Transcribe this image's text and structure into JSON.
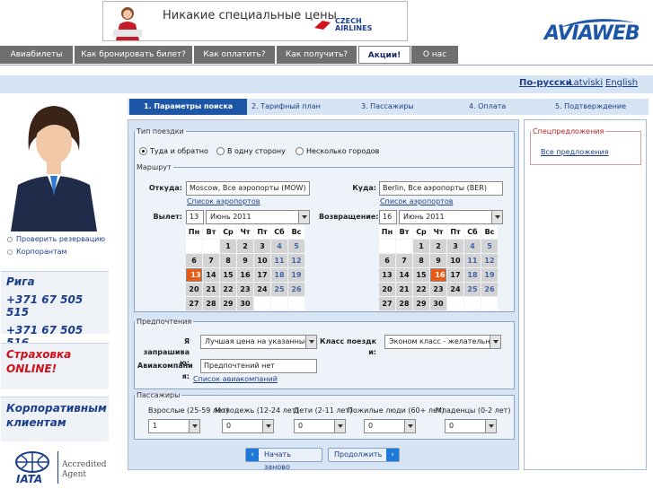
{
  "banner": {
    "text": "Никакие специальные цены",
    "airline_line1": "CZECH",
    "airline_line2": "AIRLINES"
  },
  "logo": {
    "text": "AVIAWEB"
  },
  "topnav": [
    {
      "label": "Авиабилеты",
      "active": false
    },
    {
      "label": "Как бронировать билет?",
      "active": false
    },
    {
      "label": "Как оплатить?",
      "active": false
    },
    {
      "label": "Как получить?",
      "active": false
    },
    {
      "label": "Акции!",
      "active": true
    },
    {
      "label": "О нас",
      "active": false
    }
  ],
  "languages": [
    {
      "label": "По-русски",
      "current": true
    },
    {
      "label": "Latviski",
      "current": false
    },
    {
      "label": "English",
      "current": false
    }
  ],
  "sidebar": {
    "links": [
      "Проверить резервацию",
      "Корпорантам"
    ],
    "city": "Рига",
    "phone1": "+371 67 505 515",
    "phone2": "+371 67 505 516",
    "insurance_line1": "Страховка",
    "insurance_line2": "ONLINE!",
    "corporate_line1": "Корпоративным",
    "corporate_line2": "клиентам",
    "iata_text": "IATA",
    "accredited_line1": "Accredited",
    "accredited_line2": "Agent"
  },
  "steps": [
    {
      "label": "1. Параметры поиска",
      "active": true
    },
    {
      "label": "2. Тарифный план",
      "active": false
    },
    {
      "label": "3. Пассажиры",
      "active": false
    },
    {
      "label": "4. Оплата",
      "active": false
    },
    {
      "label": "5. Подтверждение",
      "active": false
    }
  ],
  "trip_type": {
    "legend": "Тип поездки",
    "options": [
      {
        "label": "Туда и обратно",
        "checked": true
      },
      {
        "label": "В одну сторону",
        "checked": false
      },
      {
        "label": "Несколько городов",
        "checked": false
      }
    ]
  },
  "route": {
    "legend": "Маршрут",
    "from_label": "Откуда:",
    "from_value": "Moscow, Все аэропорты (MOW)",
    "to_label": "Куда:",
    "to_value": "Berlin, Все аэропорты (BER)",
    "airport_list_link": "Список аэропортов",
    "depart_label": "Вылет:",
    "depart_day": "13",
    "depart_month": "Июнь 2011",
    "return_label": "Возвращение:",
    "return_day": "16",
    "return_month": "Июнь 2011",
    "weekdays": [
      "Пн",
      "Вт",
      "Ср",
      "Чт",
      "Пт",
      "Сб",
      "Вс"
    ],
    "weeks": [
      [
        "",
        "",
        "1",
        "2",
        "3",
        "4",
        "5"
      ],
      [
        "6",
        "7",
        "8",
        "9",
        "10",
        "11",
        "12"
      ],
      [
        "13",
        "14",
        "15",
        "16",
        "17",
        "18",
        "19"
      ],
      [
        "20",
        "21",
        "22",
        "23",
        "24",
        "25",
        "26"
      ],
      [
        "27",
        "28",
        "29",
        "30",
        "",
        "",
        ""
      ]
    ]
  },
  "prefs": {
    "legend": "Предпочтения",
    "want_label_1": "Я запрашива",
    "want_label_2": "ю:",
    "want_value": "Лучшая цена на указанные д",
    "class_label_1": "Класс поездк",
    "class_label_2": "и:",
    "class_value": "Эконом класс - желательно",
    "airline_label_1": "Авиакомпани",
    "airline_label_2": "я:",
    "airline_value": "Предпочтений нет",
    "airline_list_link": "Список авиакомпаний"
  },
  "passengers": {
    "legend": "Пассажиры",
    "groups": [
      {
        "label": "Взрослые (25-59 лет)",
        "value": "1"
      },
      {
        "label": "Молодежь (12-24 лет)",
        "value": "0"
      },
      {
        "label": "Дети (2-11 лет)",
        "value": "0"
      },
      {
        "label": "Пожилые люди (60+ лет)",
        "value": "0"
      },
      {
        "label": "Младенцы (0-2 лет)",
        "value": "0"
      }
    ]
  },
  "buttons": {
    "restart": "Начать заново",
    "continue": "Продолжить"
  },
  "specials": {
    "legend": "Спецпредложения",
    "link": "Все предложения"
  }
}
